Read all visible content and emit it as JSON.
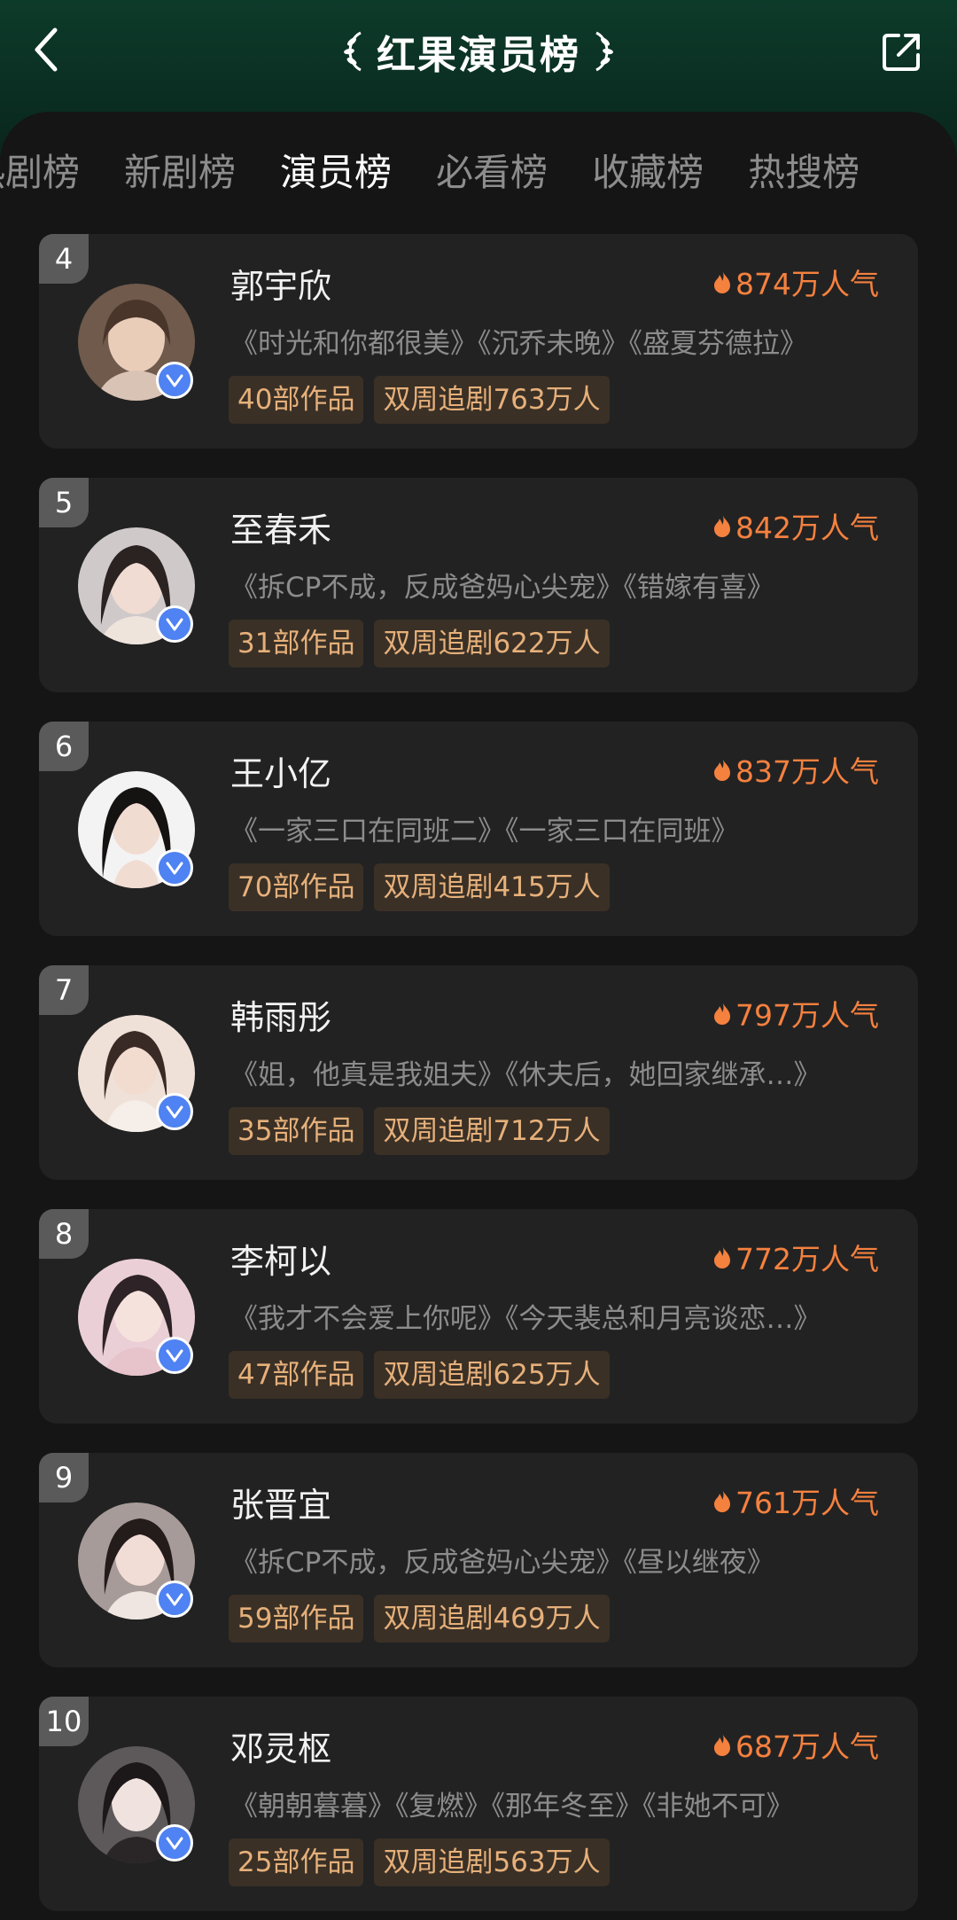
{
  "header": {
    "title": "红果演员榜",
    "back_icon": "chevron-left-icon",
    "share_icon": "share-icon"
  },
  "tabs": [
    {
      "label": "热剧榜"
    },
    {
      "label": "新剧榜"
    },
    {
      "label": "演员榜",
      "active": true
    },
    {
      "label": "必看榜"
    },
    {
      "label": "收藏榜"
    },
    {
      "label": "热搜榜"
    }
  ],
  "actors": [
    {
      "rank": "4",
      "name": "郭宇欣",
      "popularity": "874万人气",
      "works": "《时光和你都很美》《沉乔未晚》《盛夏芬德拉》",
      "count": "40部作品",
      "followers": "双周追剧763万人",
      "avatar_color": "#b9a08e"
    },
    {
      "rank": "5",
      "name": "至春禾",
      "popularity": "842万人气",
      "works": "《拆CP不成，反成爸妈心尖宠》《错嫁有喜》",
      "count": "31部作品",
      "followers": "双周追剧622万人",
      "avatar_color": "#c9c3c4"
    },
    {
      "rank": "6",
      "name": "王小亿",
      "popularity": "837万人气",
      "works": "《一家三口在同班二》《一家三口在同班》",
      "count": "70部作品",
      "followers": "双周追剧415万人",
      "avatar_color": "#e9e7e8"
    },
    {
      "rank": "7",
      "name": "韩雨彤",
      "popularity": "797万人气",
      "works": "《姐，他真是我姐夫》《休夫后，她回家继承…》",
      "count": "35部作品",
      "followers": "双周追剧712万人",
      "avatar_color": "#e6d3c9"
    },
    {
      "rank": "8",
      "name": "李柯以",
      "popularity": "772万人气",
      "works": "《我才不会爱上你呢》《今天裴总和月亮谈恋…》",
      "count": "47部作品",
      "followers": "双周追剧625万人",
      "avatar_color": "#e7c9cf"
    },
    {
      "rank": "9",
      "name": "张晋宜",
      "popularity": "761万人气",
      "works": "《拆CP不成，反成爸妈心尖宠》《昼以继夜》",
      "count": "59部作品",
      "followers": "双周追剧469万人",
      "avatar_color": "#b5aaa8"
    },
    {
      "rank": "10",
      "name": "邓灵枢",
      "popularity": "687万人气",
      "works": "《朝朝暮暮》《复燃》《那年冬至》《非她不可》",
      "count": "25部作品",
      "followers": "双周追剧563万人",
      "avatar_color": "#8f8a8c"
    }
  ],
  "colors": {
    "accent_orange": "#f5813f",
    "badge_text": "#e6b07a",
    "verified_blue": "#4f82f2"
  }
}
